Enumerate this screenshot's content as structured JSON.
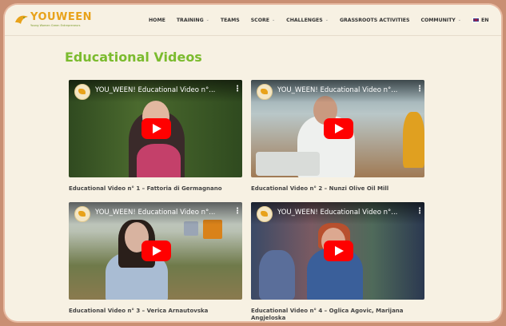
{
  "header": {
    "logo_text": "YOUWEEN",
    "logo_sub": "Young Women Green Entrepreneurs",
    "nav": [
      {
        "label": "HOME",
        "dropdown": false
      },
      {
        "label": "TRAINING",
        "dropdown": true
      },
      {
        "label": "TEAMS",
        "dropdown": false
      },
      {
        "label": "SCORE",
        "dropdown": true
      },
      {
        "label": "CHALLENGES",
        "dropdown": true
      },
      {
        "label": "GRASSROOTS ACTIVITIES",
        "dropdown": false
      },
      {
        "label": "COMMUNITY",
        "dropdown": true
      }
    ],
    "language": "EN"
  },
  "main": {
    "title": "Educational Videos",
    "videos": [
      {
        "title": "YOU_WEEN! Educational Video n°...",
        "caption": "Educational Video n° 1 – Fattoria di Germagnano"
      },
      {
        "title": "YOU_WEEN! Educational Video n°...",
        "caption": "Educational Video n° 2 – Nunzi Olive Oil Mill"
      },
      {
        "title": "YOU_WEEN! Educational Video n°...",
        "caption": "Educational Video n° 3 – Verica Arnautovska"
      },
      {
        "title": "YOU_WEEN! Educational Video n°...",
        "caption": "Educational Video n° 4 – Oglica Agovic, Marijana Angjeloska"
      }
    ]
  },
  "colors": {
    "background": "#c98f73",
    "page": "#f7f1e3",
    "accent_green": "#7bbb2e",
    "logo_orange": "#e8a21a",
    "play_red": "#ff0000"
  }
}
